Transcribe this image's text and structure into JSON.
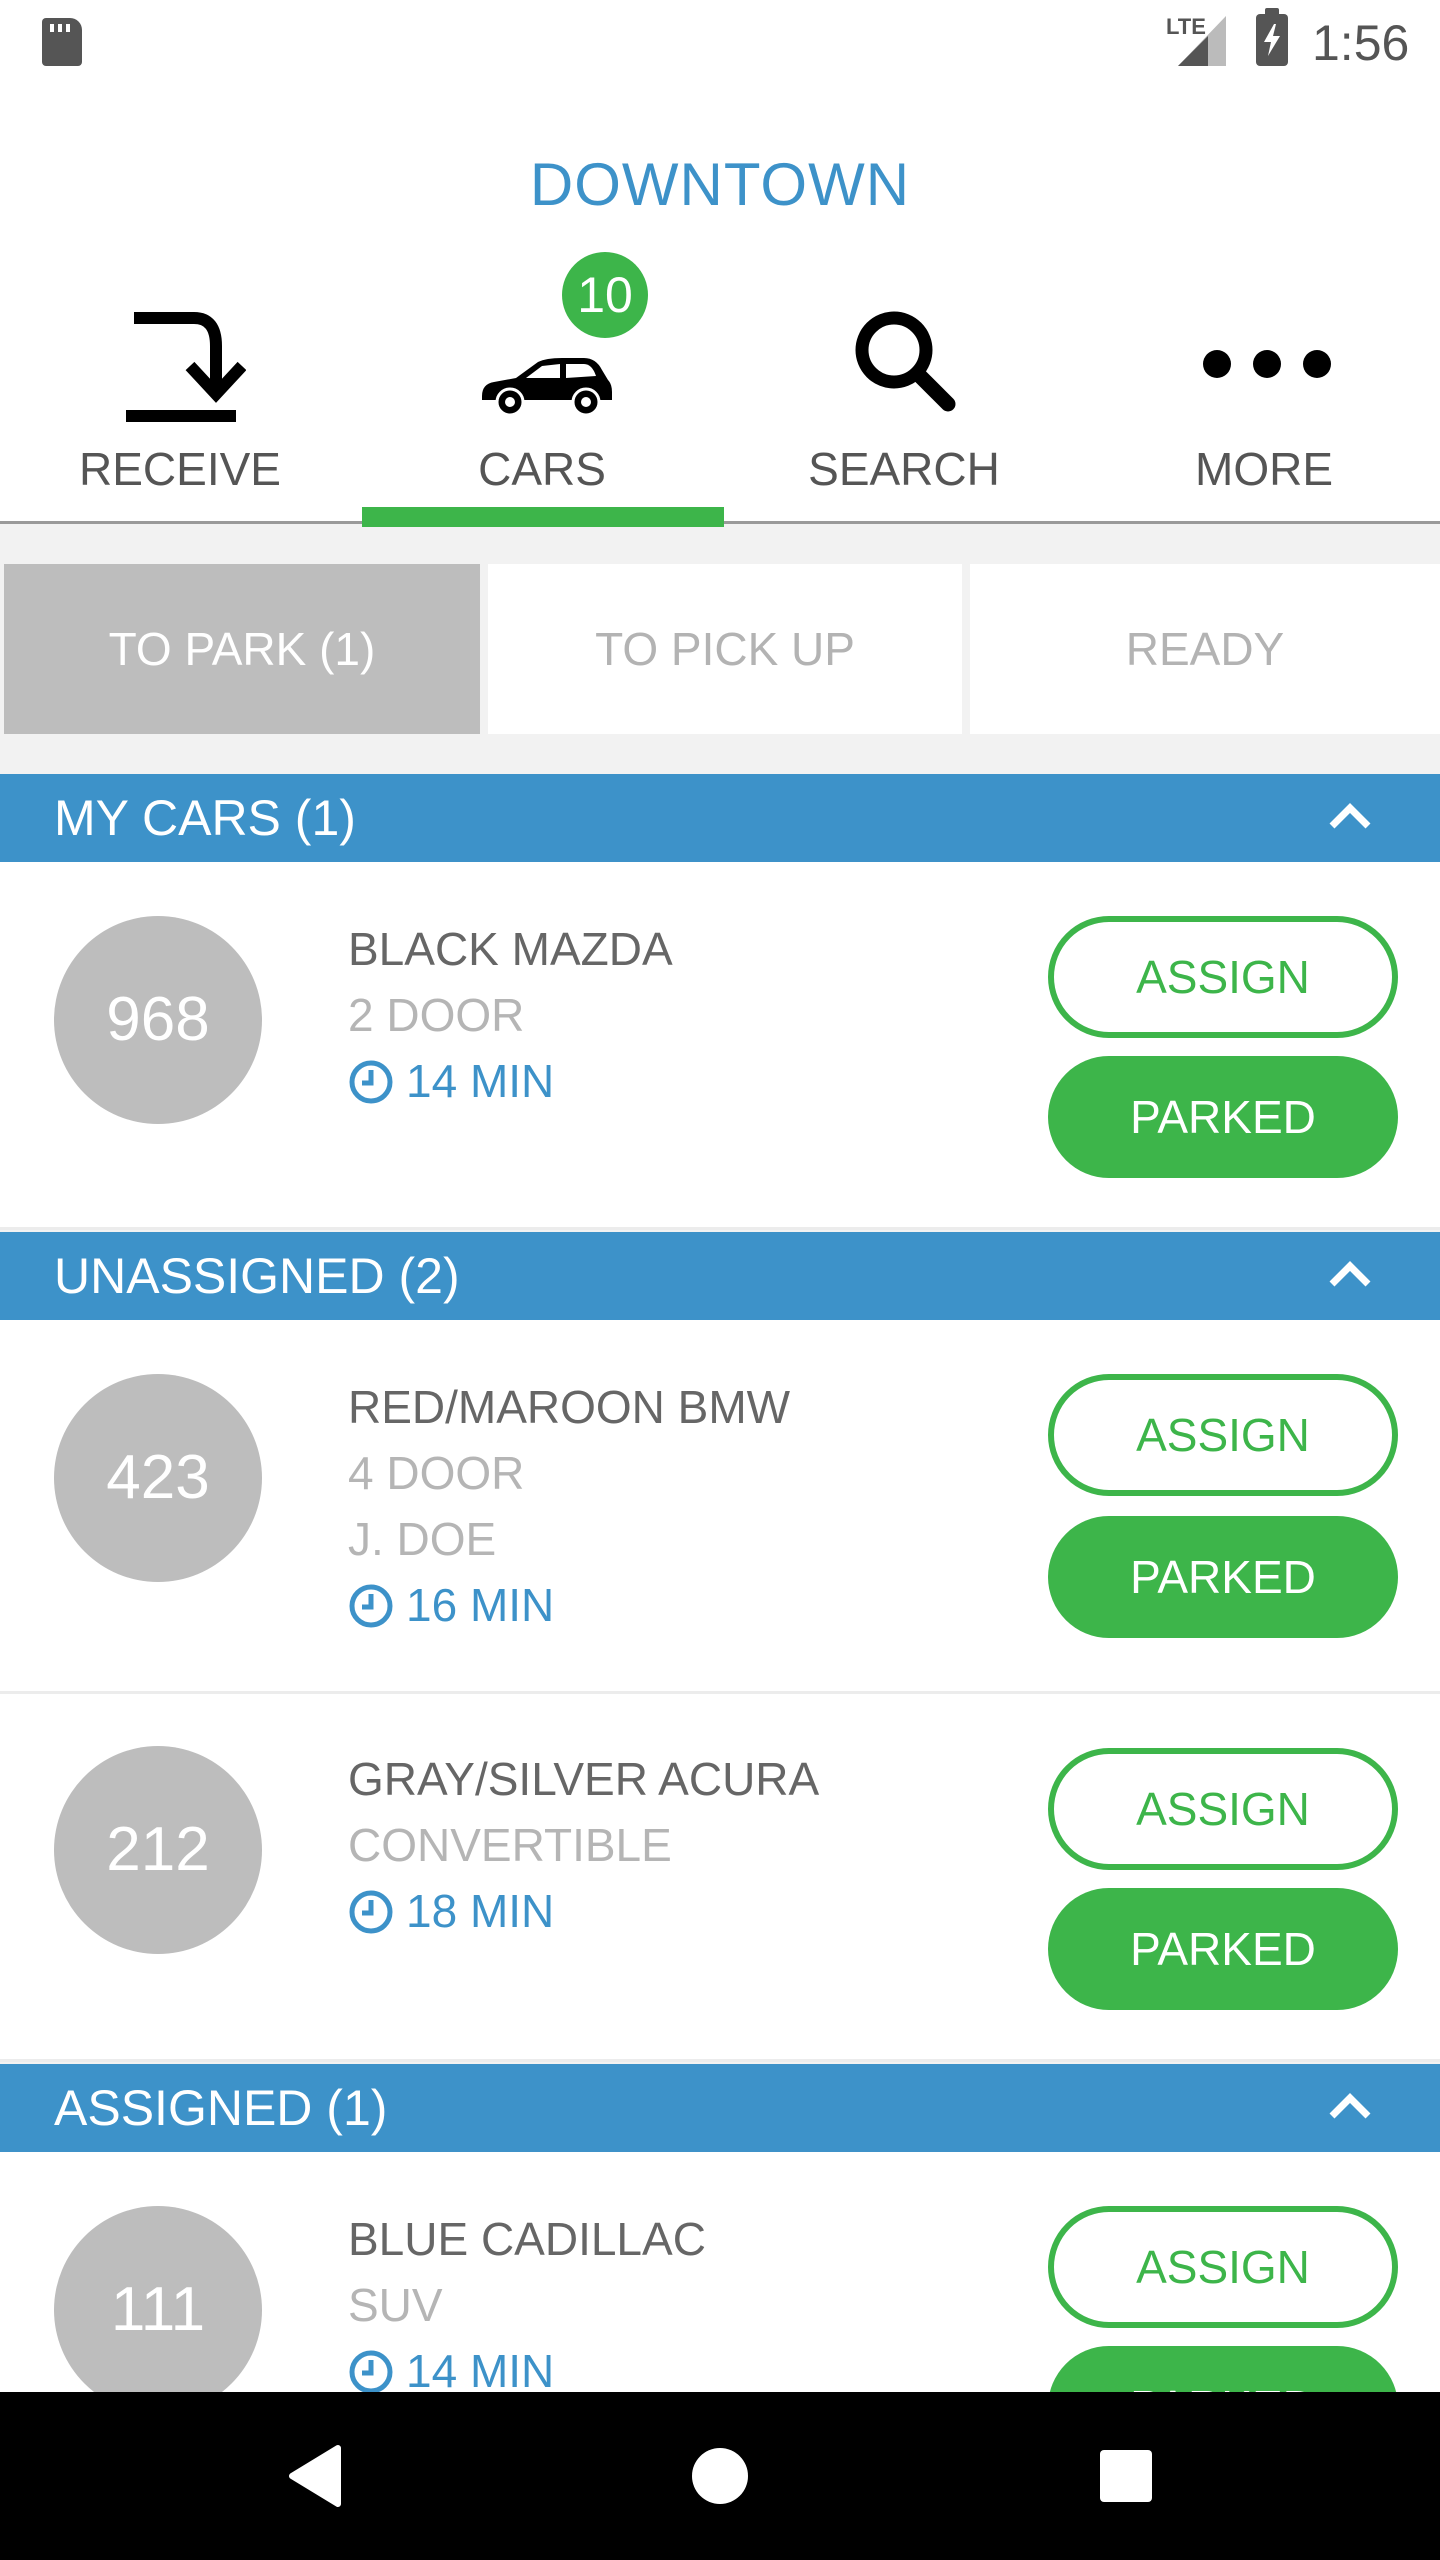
{
  "status_bar": {
    "network": "LTE",
    "time": "1:56"
  },
  "header": {
    "location": "DOWNTOWN"
  },
  "nav": {
    "receive": "RECEIVE",
    "cars": "CARS",
    "cars_badge": "10",
    "search": "SEARCH",
    "more": "MORE"
  },
  "filters": {
    "to_park": "TO PARK (1)",
    "to_pick_up": "TO PICK UP",
    "ready": "READY"
  },
  "sections": {
    "my_cars": "MY CARS (1)",
    "unassigned": "UNASSIGNED (2)",
    "assigned": "ASSIGNED (1)"
  },
  "buttons": {
    "assign": "ASSIGN",
    "parked": "PARKED"
  },
  "cars": [
    {
      "ticket": "968",
      "name": "BLACK MAZDA",
      "detail": "2 DOOR",
      "time": "14 MIN"
    },
    {
      "ticket": "423",
      "name": "RED/MAROON BMW",
      "detail": "4 DOOR",
      "owner": "J. DOE",
      "time": "16 MIN"
    },
    {
      "ticket": "212",
      "name": "GRAY/SILVER ACURA",
      "detail": "CONVERTIBLE",
      "time": "18 MIN"
    },
    {
      "ticket": "111",
      "name": "BLUE CADILLAC",
      "detail": "SUV",
      "time": "14 MIN"
    }
  ],
  "colors": {
    "accent_blue": "#3d92c9",
    "accent_green": "#3db54a",
    "gray": "#bdbdbd"
  }
}
